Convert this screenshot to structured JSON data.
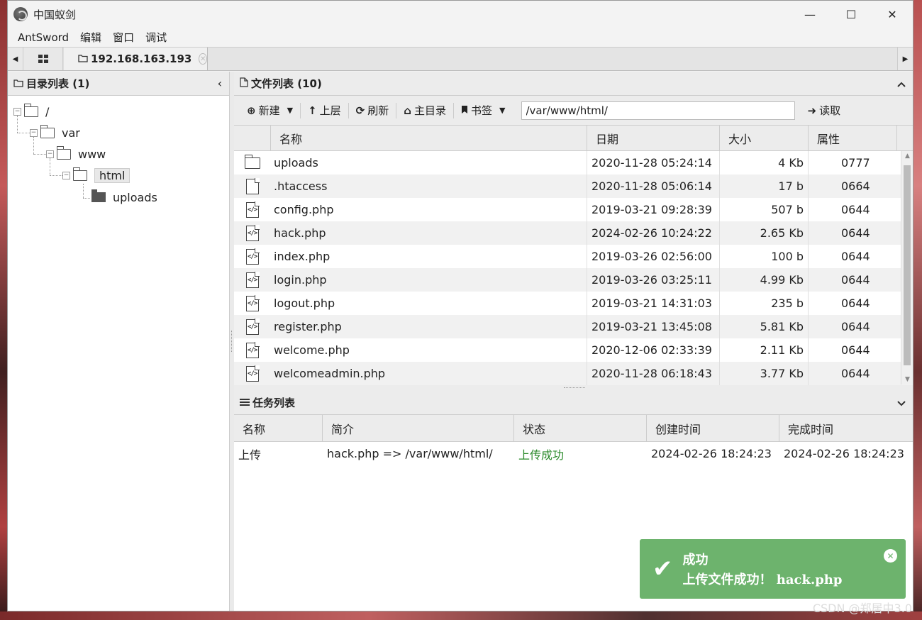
{
  "window": {
    "title": "中国蚁剑",
    "minimize": "—",
    "maximize": "☐",
    "close": "✕"
  },
  "menu": [
    "AntSword",
    "编辑",
    "窗口",
    "调试"
  ],
  "tabs": {
    "home_icon": "grid-icon",
    "active_tab": "192.168.163.193"
  },
  "dir_panel": {
    "title": "目录列表 (1)",
    "tree": [
      {
        "label": "/",
        "depth": 0
      },
      {
        "label": "var",
        "depth": 1
      },
      {
        "label": "www",
        "depth": 2
      },
      {
        "label": "html",
        "depth": 3,
        "selected": true
      },
      {
        "label": "uploads",
        "depth": 4
      }
    ]
  },
  "file_panel": {
    "title": "文件列表 (10)",
    "toolbar": {
      "new": "新建",
      "up": "上层",
      "refresh": "刷新",
      "home": "主目录",
      "bookmark": "书签",
      "path": "/var/www/html/",
      "read": "读取"
    },
    "columns": [
      "名称",
      "日期",
      "大小",
      "属性"
    ],
    "files": [
      {
        "type": "folder",
        "name": "uploads",
        "date": "2020-11-28 05:24:14",
        "size": "4 Kb",
        "attr": "0777"
      },
      {
        "type": "file",
        "name": ".htaccess",
        "date": "2020-11-28 05:06:14",
        "size": "17 b",
        "attr": "0664"
      },
      {
        "type": "code",
        "name": "config.php",
        "date": "2019-03-21 09:28:39",
        "size": "507 b",
        "attr": "0644"
      },
      {
        "type": "code",
        "name": "hack.php",
        "date": "2024-02-26 10:24:22",
        "size": "2.65 Kb",
        "attr": "0644"
      },
      {
        "type": "code",
        "name": "index.php",
        "date": "2019-03-26 02:56:00",
        "size": "100 b",
        "attr": "0644"
      },
      {
        "type": "code",
        "name": "login.php",
        "date": "2019-03-26 03:25:11",
        "size": "4.99 Kb",
        "attr": "0644"
      },
      {
        "type": "code",
        "name": "logout.php",
        "date": "2019-03-21 14:31:03",
        "size": "235 b",
        "attr": "0644"
      },
      {
        "type": "code",
        "name": "register.php",
        "date": "2019-03-21 13:45:08",
        "size": "5.81 Kb",
        "attr": "0644"
      },
      {
        "type": "code",
        "name": "welcome.php",
        "date": "2020-12-06 02:33:39",
        "size": "2.11 Kb",
        "attr": "0644"
      },
      {
        "type": "code",
        "name": "welcomeadmin.php",
        "date": "2020-11-28 06:18:43",
        "size": "3.77 Kb",
        "attr": "0644"
      }
    ]
  },
  "task_panel": {
    "title": "任务列表",
    "columns": [
      "名称",
      "简介",
      "状态",
      "创建时间",
      "完成时间"
    ],
    "tasks": [
      {
        "name": "上传",
        "desc": "hack.php => /var/www/html/",
        "status": "上传成功",
        "created": "2024-02-26 18:24:23",
        "finished": "2024-02-26 18:24:23"
      }
    ]
  },
  "toast": {
    "title": "成功",
    "message": "上传文件成功！ hack.php"
  },
  "watermark": "CSDN @郑居中3.0",
  "colors": {
    "toast_bg": "#6db36d",
    "status_ok": "#2a8a2a"
  }
}
